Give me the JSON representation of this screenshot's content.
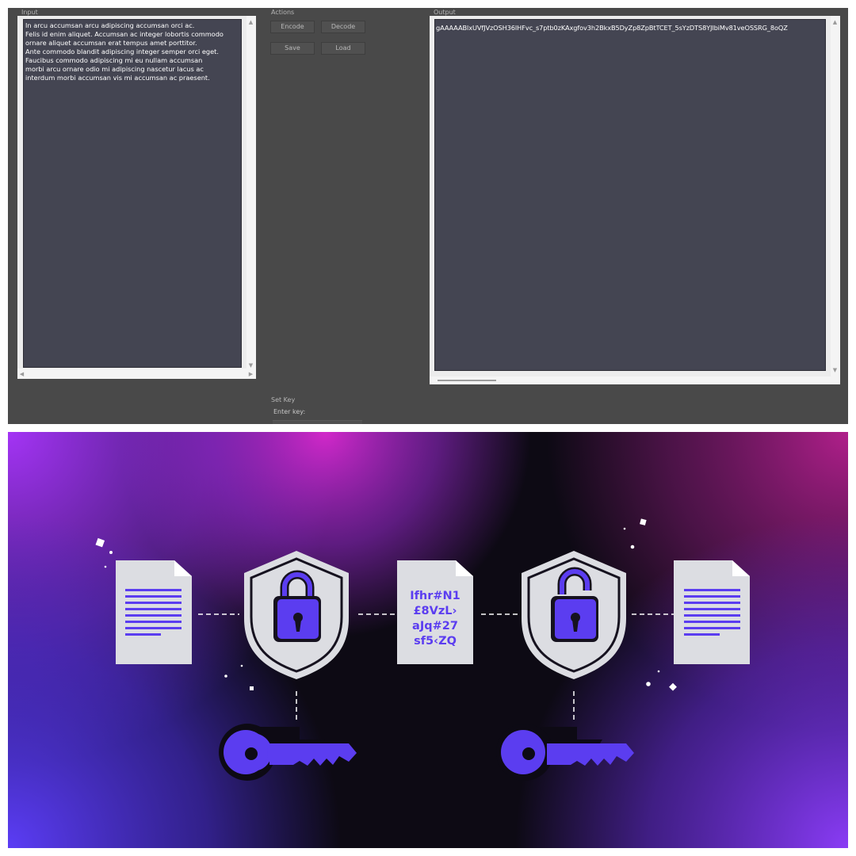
{
  "window": {
    "input_label": "Input",
    "actions_label": "Actions",
    "output_label": "Output",
    "setkey_label": "Set Key",
    "enter_key_label": "Enter key:"
  },
  "input": {
    "line1": "In arcu accumsan arcu adipiscing accumsan orci ac.",
    "line2": "Felis id enim aliquet. Accumsan ac integer lobortis commodo",
    "line3": "ornare aliquet accumsan erat tempus amet porttitor.",
    "line4": "Ante commodo blandit adipiscing integer semper orci eget.",
    "line5": "Faucibus commodo adipiscing mi eu nullam accumsan",
    "line6": "morbi arcu ornare odio mi adipiscing nascetur lacus ac",
    "line7": "interdum morbi accumsan vis mi accumsan ac praesent."
  },
  "buttons": {
    "encode": "Encode",
    "decode": "Decode",
    "save": "Save",
    "load": "Load"
  },
  "output": {
    "text": "gAAAAABlxUVfJVzOSH36IHFvc_s7ptb0zKAxgfov3h2BkxB5DyZp8ZpBtTCET_5sYzDTS8YJlbiMv81veOSSRG_8oQZ"
  },
  "key": {
    "value": ""
  },
  "illustration": {
    "cipher_line1": "Ifhr#N1",
    "cipher_line2": "£8VzL›",
    "cipher_line3": "aJq#27",
    "cipher_line4": "sf5‹ZQ",
    "colors": {
      "accent": "#5b3df0",
      "magenta": "#c525c8",
      "purple": "#9a3cf0",
      "dark": "#0d0a14",
      "paper": "#dcdde2"
    }
  }
}
